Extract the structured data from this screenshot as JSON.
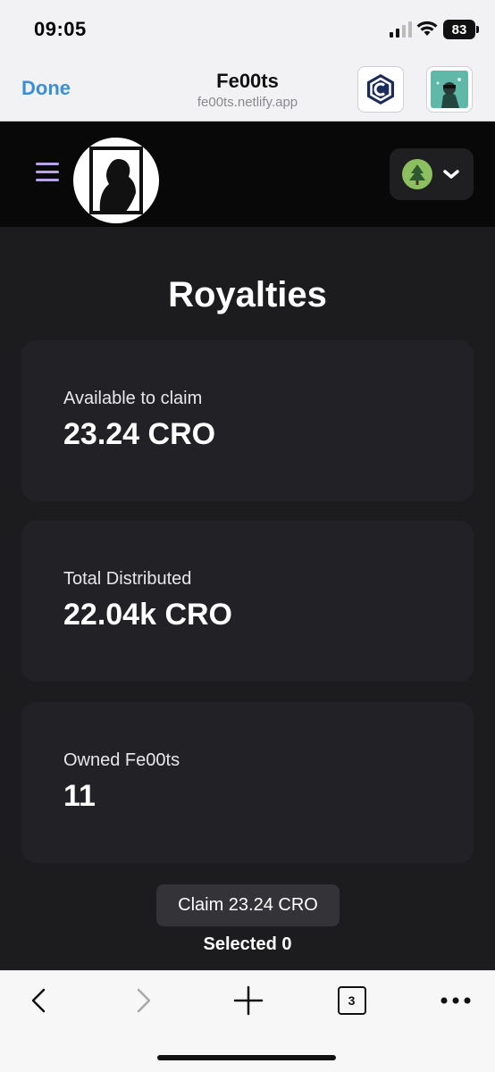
{
  "status_bar": {
    "time": "09:05",
    "battery": "83",
    "icons": [
      "signal-icon",
      "wifi-icon",
      "battery-icon"
    ]
  },
  "browser": {
    "done_label": "Done",
    "site_title": "Fe00ts",
    "site_url": "fe00ts.netlify.app",
    "extension_icons": [
      "crypto-com-icon",
      "user-nft-avatar-icon"
    ]
  },
  "nav": {
    "menu_icon": "hamburger-menu-icon",
    "logo_icon": "fe00ts-logo",
    "account_icon": "tree-avatar-icon",
    "dropdown_icon": "chevron-down-icon"
  },
  "page": {
    "title": "Royalties",
    "cards": [
      {
        "label": "Available to claim",
        "value": "23.24 CRO"
      },
      {
        "label": "Total Distributed",
        "value": "22.04k CRO"
      },
      {
        "label": "Owned Fe00ts",
        "value": "11"
      }
    ],
    "claim_button": "Claim 23.24 CRO",
    "selected_text": "Selected 0"
  },
  "toolbar": {
    "tabs_count": "3",
    "icons": [
      "back-icon",
      "forward-icon",
      "new-tab-icon",
      "tabs-icon",
      "more-icon"
    ]
  },
  "colors": {
    "background": "#1c1c1e",
    "card": "#222226",
    "nav": "#080808",
    "link_blue": "#3b8fd8",
    "menu_purple": "#b7a3e6",
    "avatar_green": "#8bbf5f"
  }
}
